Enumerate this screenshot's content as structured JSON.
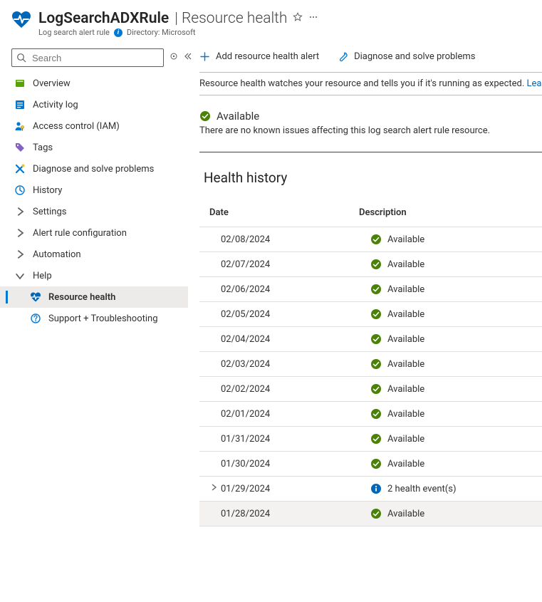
{
  "header": {
    "title": "LogSearchADXRule",
    "suffix": "| Resource health",
    "subtype": "Log search alert rule",
    "dir_label": "Directory: Microsoft"
  },
  "sidebar": {
    "search_placeholder": "Search",
    "items": [
      {
        "label": "Overview"
      },
      {
        "label": "Activity log"
      },
      {
        "label": "Access control (IAM)"
      },
      {
        "label": "Tags"
      },
      {
        "label": "Diagnose and solve problems"
      },
      {
        "label": "History"
      },
      {
        "label": "Settings"
      },
      {
        "label": "Alert rule configuration"
      },
      {
        "label": "Automation"
      },
      {
        "label": "Help"
      },
      {
        "label": "Resource health"
      },
      {
        "label": "Support + Troubleshooting"
      }
    ]
  },
  "toolbar": {
    "add_alert": "Add resource health alert",
    "diagnose": "Diagnose and solve problems"
  },
  "info_bar": {
    "text": "Resource health watches your resource and tells you if it's running as expected.",
    "link": "Lea"
  },
  "status": {
    "label": "Available",
    "sub": "There are no known issues affecting this log search alert rule resource."
  },
  "history": {
    "title": "Health history",
    "col_date": "Date",
    "col_desc": "Description",
    "rows": [
      {
        "date": "02/08/2024",
        "status": "ok",
        "desc": "Available"
      },
      {
        "date": "02/07/2024",
        "status": "ok",
        "desc": "Available"
      },
      {
        "date": "02/06/2024",
        "status": "ok",
        "desc": "Available"
      },
      {
        "date": "02/05/2024",
        "status": "ok",
        "desc": "Available"
      },
      {
        "date": "02/04/2024",
        "status": "ok",
        "desc": "Available"
      },
      {
        "date": "02/03/2024",
        "status": "ok",
        "desc": "Available"
      },
      {
        "date": "02/02/2024",
        "status": "ok",
        "desc": "Available"
      },
      {
        "date": "02/01/2024",
        "status": "ok",
        "desc": "Available"
      },
      {
        "date": "01/31/2024",
        "status": "ok",
        "desc": "Available"
      },
      {
        "date": "01/30/2024",
        "status": "ok",
        "desc": "Available"
      },
      {
        "date": "01/29/2024",
        "status": "info",
        "desc": "2 health event(s)",
        "chevron": true
      },
      {
        "date": "01/28/2024",
        "status": "ok",
        "desc": "Available",
        "hover": true
      }
    ]
  }
}
